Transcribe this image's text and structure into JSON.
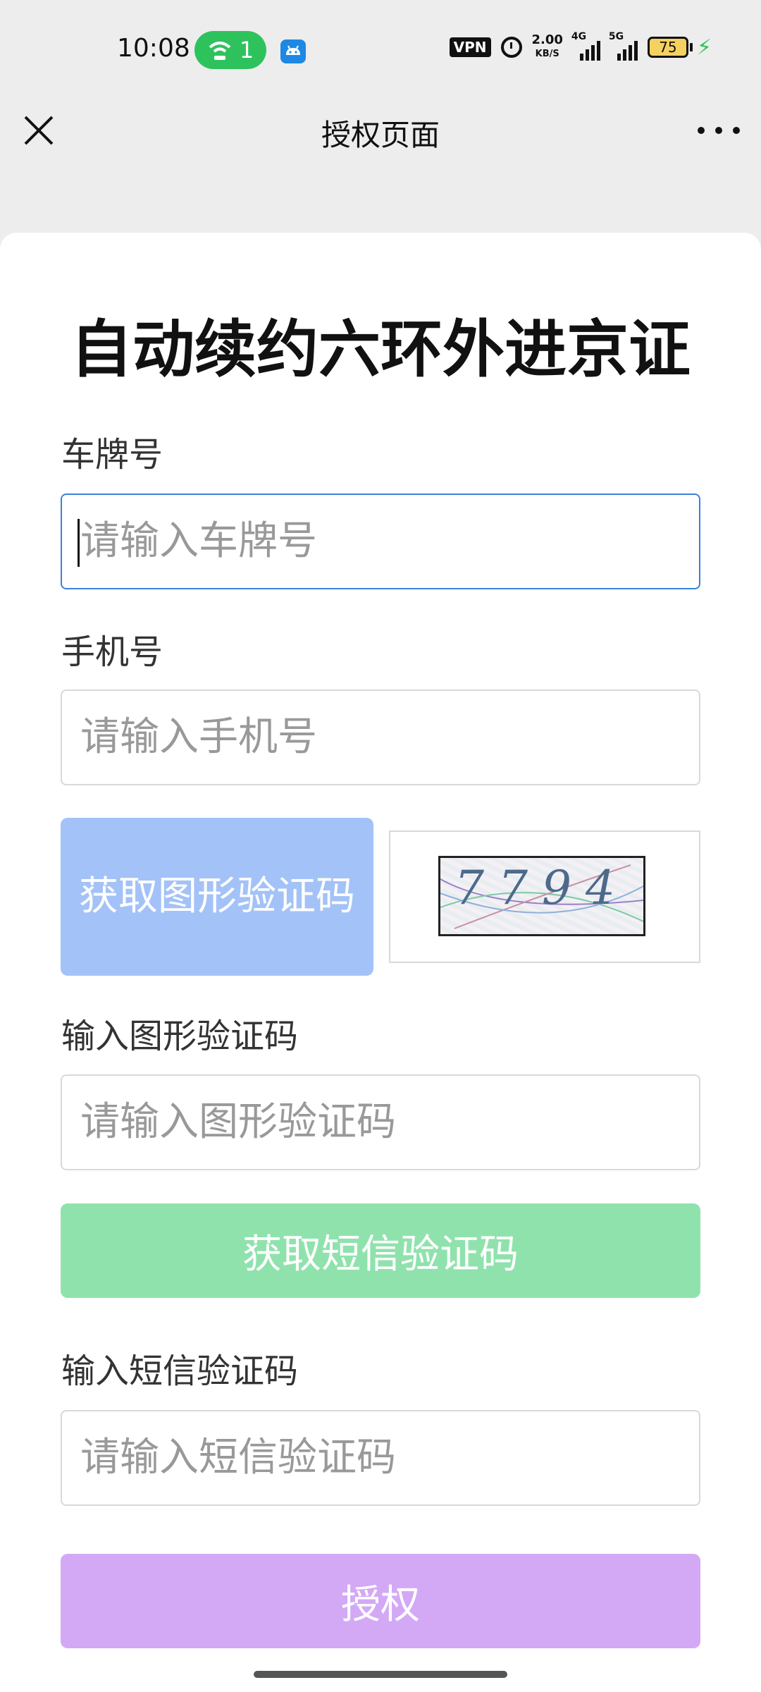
{
  "status_bar": {
    "time": "10:08",
    "hotspot_count": "1",
    "vpn_label": "VPN",
    "speed_value": "2.00",
    "speed_unit": "KB/S",
    "signal1_label": "4G",
    "signal2_label": "5G",
    "battery_level": "75"
  },
  "header": {
    "title": "授权页面"
  },
  "form": {
    "title": "自动续约六环外进京证",
    "plate": {
      "label": "车牌号",
      "placeholder": "请输入车牌号"
    },
    "phone": {
      "label": "手机号",
      "placeholder": "请输入手机号"
    },
    "captcha_button_label": "获取图形验证码",
    "captcha_image_text": "7794",
    "captcha_input": {
      "label": "输入图形验证码",
      "placeholder": "请输入图形验证码"
    },
    "sms_button_label": "获取短信验证码",
    "sms_input": {
      "label": "输入短信验证码",
      "placeholder": "请输入短信验证码"
    },
    "submit_label": "授权"
  },
  "colors": {
    "captcha_button": "#a3c2f7",
    "sms_button": "#90e2ad",
    "submit_button": "#d3a9f5",
    "focus_border": "#3b82d8",
    "hotspot_pill": "#2ec25d"
  }
}
